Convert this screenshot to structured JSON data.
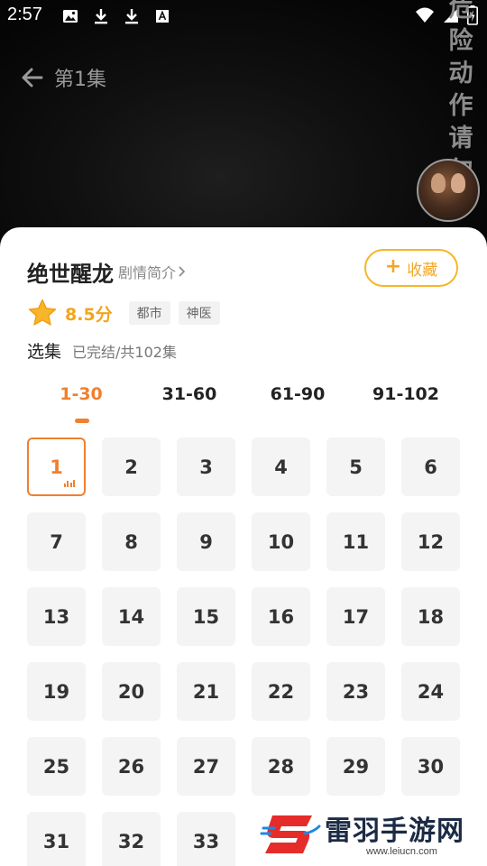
{
  "status_bar": {
    "time": "2:57",
    "icons_left": [
      "image-icon",
      "download-icon",
      "download-icon",
      "font-icon"
    ],
    "icons_right": [
      "wifi-icon",
      "signal-icon",
      "battery-charging-icon"
    ]
  },
  "player": {
    "episode_title": "第1集",
    "side_warning": [
      "危",
      "险",
      "动",
      "作",
      "请",
      "勿"
    ]
  },
  "drama": {
    "title": "绝世醒龙",
    "synopsis_label": "剧情简介",
    "favorite_label": "收藏",
    "rating": "8.5分",
    "tags": [
      "都市",
      "神医"
    ]
  },
  "episodes": {
    "label": "选集",
    "status": "已完结/共102集",
    "tabs": [
      "1-30",
      "31-60",
      "61-90",
      "91-102"
    ],
    "active_tab": 0,
    "list": [
      "1",
      "2",
      "3",
      "4",
      "5",
      "6",
      "7",
      "8",
      "9",
      "10",
      "11",
      "12",
      "13",
      "14",
      "15",
      "16",
      "17",
      "18",
      "19",
      "20",
      "21",
      "22",
      "23",
      "24",
      "25",
      "26",
      "27",
      "28",
      "29",
      "30",
      "31",
      "32",
      "33"
    ],
    "playing": "1"
  },
  "watermark": {
    "name": "雷羽手游网",
    "url": "www.leiucn.com"
  },
  "colors": {
    "accent": "#f0802f",
    "favorite": "#f5a623",
    "rating": "#f2a51c"
  }
}
